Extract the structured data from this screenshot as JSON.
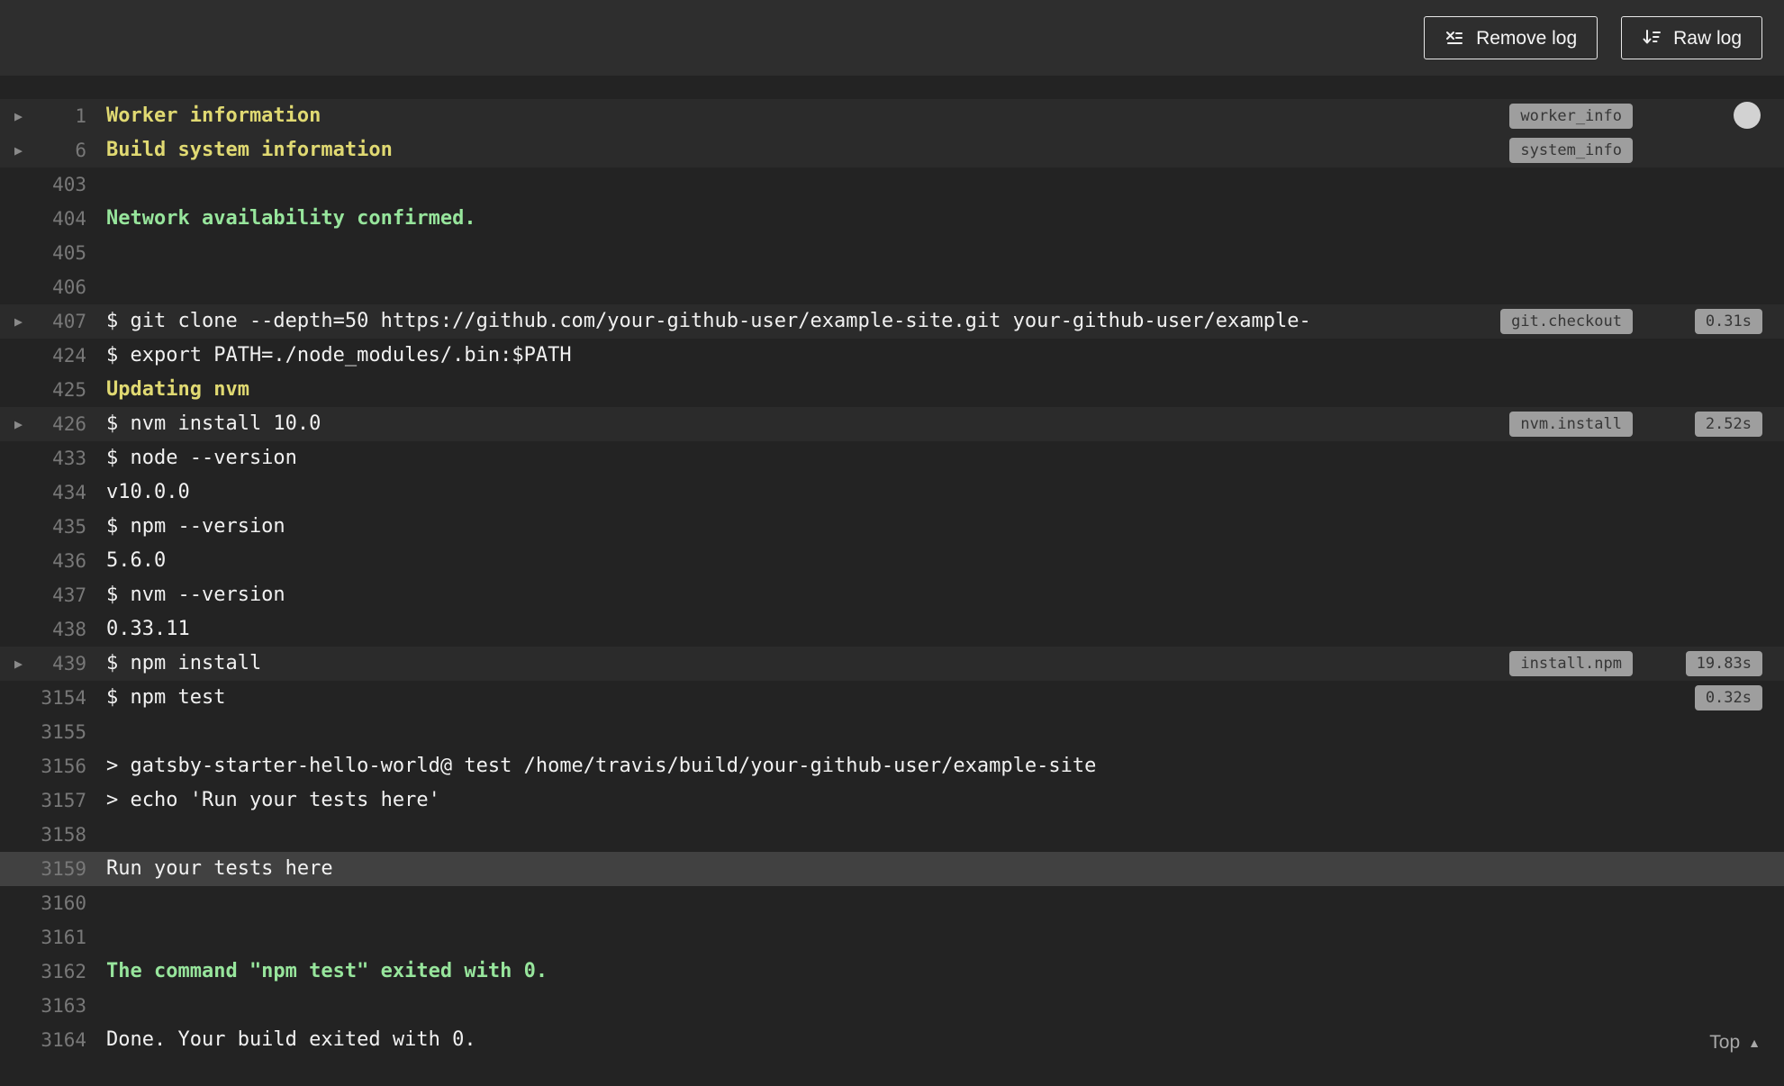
{
  "toolbar": {
    "remove_log_label": "Remove log",
    "raw_log_label": "Raw log"
  },
  "icons": {
    "remove_log_icon": "x-over-list",
    "raw_log_icon": "down-arrow-with-lines",
    "fold_arrow_icon": "▶",
    "top_icon": "▲"
  },
  "colors": {
    "background": "#232323",
    "topbar": "#2e2e2e",
    "fold_row": "#2b2b2b",
    "highlight_row": "#414141",
    "yellow": "#e0d972",
    "green": "#97e59c",
    "text": "#f1f1f1",
    "line_number": "#787878",
    "badge_bg": "#9e9e9e",
    "badge_text": "#363636"
  },
  "footer": {
    "top_label": "Top"
  },
  "log": {
    "lines": [
      {
        "num": "1",
        "text": "Worker information",
        "color": "yellow",
        "fold": true,
        "badge": "worker_info",
        "row": "fold-header"
      },
      {
        "num": "6",
        "text": "Build system information",
        "color": "yellow",
        "fold": true,
        "badge": "system_info",
        "row": "fold-header"
      },
      {
        "num": "403",
        "text": ""
      },
      {
        "num": "404",
        "text": "Network availability confirmed.",
        "color": "green"
      },
      {
        "num": "405",
        "text": ""
      },
      {
        "num": "406",
        "text": ""
      },
      {
        "num": "407",
        "text": "$ git clone --depth=50 https://github.com/your-github-user/example-site.git your-github-user/example-",
        "fold": true,
        "badge": "git.checkout",
        "time": "0.31s",
        "row": "fold-header"
      },
      {
        "num": "424",
        "text": "$ export PATH=./node_modules/.bin:$PATH"
      },
      {
        "num": "425",
        "text": "Updating nvm",
        "color": "yellow"
      },
      {
        "num": "426",
        "text": "$ nvm install 10.0",
        "fold": true,
        "badge": "nvm.install",
        "time": "2.52s",
        "row": "fold-header"
      },
      {
        "num": "433",
        "text": "$ node --version"
      },
      {
        "num": "434",
        "text": "v10.0.0"
      },
      {
        "num": "435",
        "text": "$ npm --version"
      },
      {
        "num": "436",
        "text": "5.6.0"
      },
      {
        "num": "437",
        "text": "$ nvm --version"
      },
      {
        "num": "438",
        "text": "0.33.11"
      },
      {
        "num": "439",
        "text": "$ npm install",
        "fold": true,
        "badge": "install.npm",
        "time": "19.83s",
        "row": "fold-header"
      },
      {
        "num": "3154",
        "text": "$ npm test",
        "time": "0.32s"
      },
      {
        "num": "3155",
        "text": ""
      },
      {
        "num": "3156",
        "text": "> gatsby-starter-hello-world@ test /home/travis/build/your-github-user/example-site"
      },
      {
        "num": "3157",
        "text": "> echo 'Run your tests here'"
      },
      {
        "num": "3158",
        "text": ""
      },
      {
        "num": "3159",
        "text": "Run your tests here",
        "row": "highlight"
      },
      {
        "num": "3160",
        "text": ""
      },
      {
        "num": "3161",
        "text": ""
      },
      {
        "num": "3162",
        "text": "The command \"npm test\" exited with 0.",
        "color": "green"
      },
      {
        "num": "3163",
        "text": ""
      },
      {
        "num": "3164",
        "text": "Done. Your build exited with 0."
      }
    ]
  }
}
